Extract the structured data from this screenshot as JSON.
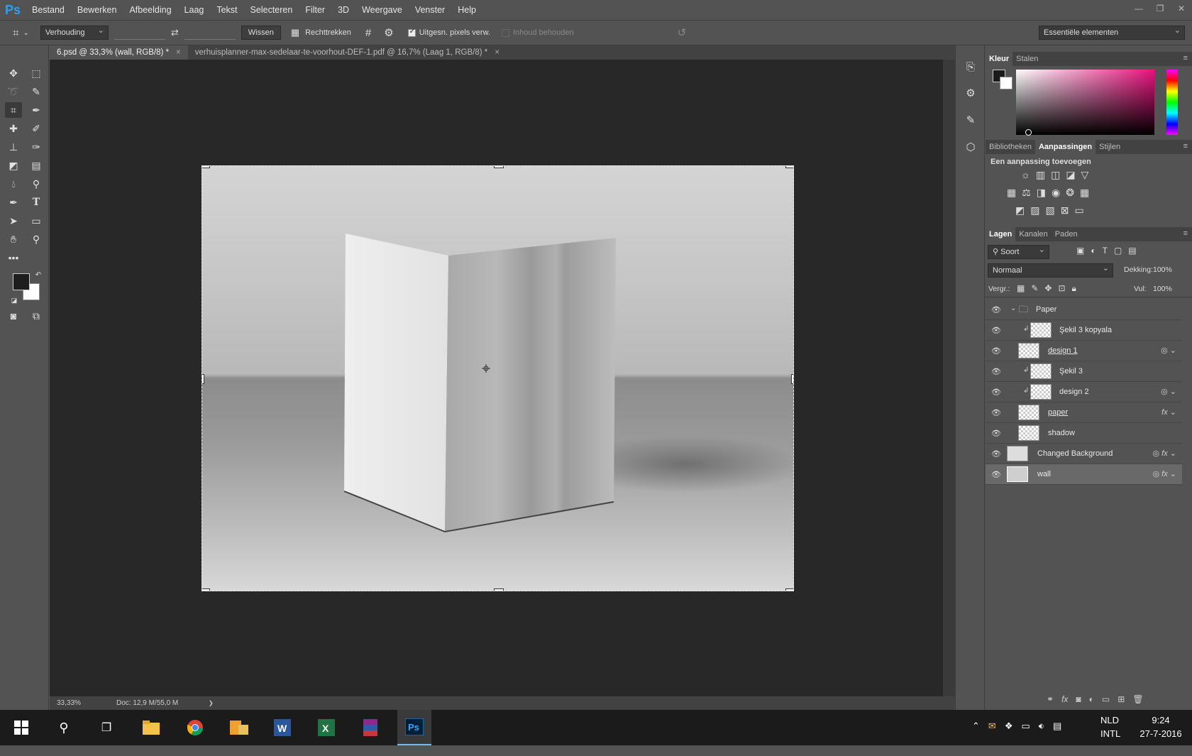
{
  "app": {
    "logo": "Ps"
  },
  "menu": [
    "Bestand",
    "Bewerken",
    "Afbeelding",
    "Laag",
    "Tekst",
    "Selecteren",
    "Filter",
    "3D",
    "Weergave",
    "Venster",
    "Help"
  ],
  "options": {
    "ratio_select": "Verhouding",
    "clear_button": "Wissen",
    "straighten_label": "Rechttrekken",
    "delete_cropped_label": "Uitgesn. pixels verw.",
    "content_aware_label": "Inhoud behouden",
    "workspace_select": "Essentiële elementen"
  },
  "tabs": [
    {
      "label": "6.psd @ 33,3% (wall, RGB/8) *",
      "close": "×"
    },
    {
      "label": "verhuisplanner-max-sedelaar-te-voorhout-DEF-1.pdf @ 16,7% (Laag 1, RGB/8) *",
      "close": "×"
    }
  ],
  "status": {
    "zoom": "33,33%",
    "doc": "Doc: 12,9 M/55,0 M",
    "arrow": "❯"
  },
  "color_panel": {
    "tabs": [
      "Kleur",
      "Stalen"
    ],
    "menu": "≡"
  },
  "adjust_panel": {
    "tabs": [
      "Bibliotheken",
      "Aanpassingen",
      "Stijlen"
    ],
    "heading": "Een aanpassing toevoegen"
  },
  "layers_panel": {
    "tabs": [
      "Lagen",
      "Kanalen",
      "Paden"
    ],
    "filter": "Soort",
    "blend_mode": "Normaal",
    "opacity_label": "Dekking:",
    "opacity_value": "100%",
    "lock_label": "Vergr.:",
    "fill_label": "Vul:",
    "fill_value": "100%",
    "layers": [
      {
        "name": "Paper",
        "kind": "group"
      },
      {
        "name": "Şekil 3 kopyala",
        "kind": "clip"
      },
      {
        "name": "design 1",
        "kind": "smart"
      },
      {
        "name": "Şekil 3",
        "kind": "clip"
      },
      {
        "name": "design 2",
        "kind": "clip-smart"
      },
      {
        "name": "paper",
        "kind": "smart",
        "fx": "fx"
      },
      {
        "name": "shadow",
        "kind": "normal"
      },
      {
        "name": "Changed Background",
        "kind": "smart",
        "fx": "fx"
      },
      {
        "name": "wall",
        "kind": "smart",
        "fx": "fx",
        "selected": true
      }
    ]
  },
  "taskbar": {
    "lang_top": "NLD",
    "lang_bottom": "INTL",
    "time": "9:24",
    "date": "27-7-2016"
  },
  "colors": {
    "accent": "#2da0f0",
    "panel": "#535353",
    "workspace": "#282828"
  }
}
